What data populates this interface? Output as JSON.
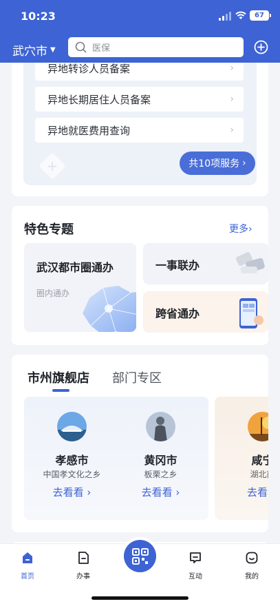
{
  "status_bar": {
    "time": "10:23",
    "battery": "67"
  },
  "header": {
    "city": "武穴市",
    "search_placeholder": "医保"
  },
  "services": {
    "items": [
      "异地转诊人员备案",
      "异地长期居住人员备案",
      "异地就医费用查询"
    ],
    "all_button": "共10项服务"
  },
  "featured": {
    "title": "特色专题",
    "more": "更多",
    "big_card": {
      "title": "武汉都市圈通办",
      "subtitle": "圈内通办"
    },
    "small_cards": [
      "一事联办",
      "跨省通办"
    ]
  },
  "stores": {
    "tabs": [
      "市州旗舰店",
      "部门专区"
    ],
    "cities": [
      {
        "name": "孝感市",
        "desc": "中国孝文化之乡",
        "link": "去看看"
      },
      {
        "name": "黄冈市",
        "desc": "板栗之乡",
        "link": "去看看"
      },
      {
        "name": "咸宁",
        "desc": "湖北南",
        "link": "去看看"
      }
    ]
  },
  "bottom_nav": {
    "items": [
      "首页",
      "办事",
      "互动",
      "我的"
    ]
  },
  "colors": {
    "primary": "#3d63d4"
  }
}
